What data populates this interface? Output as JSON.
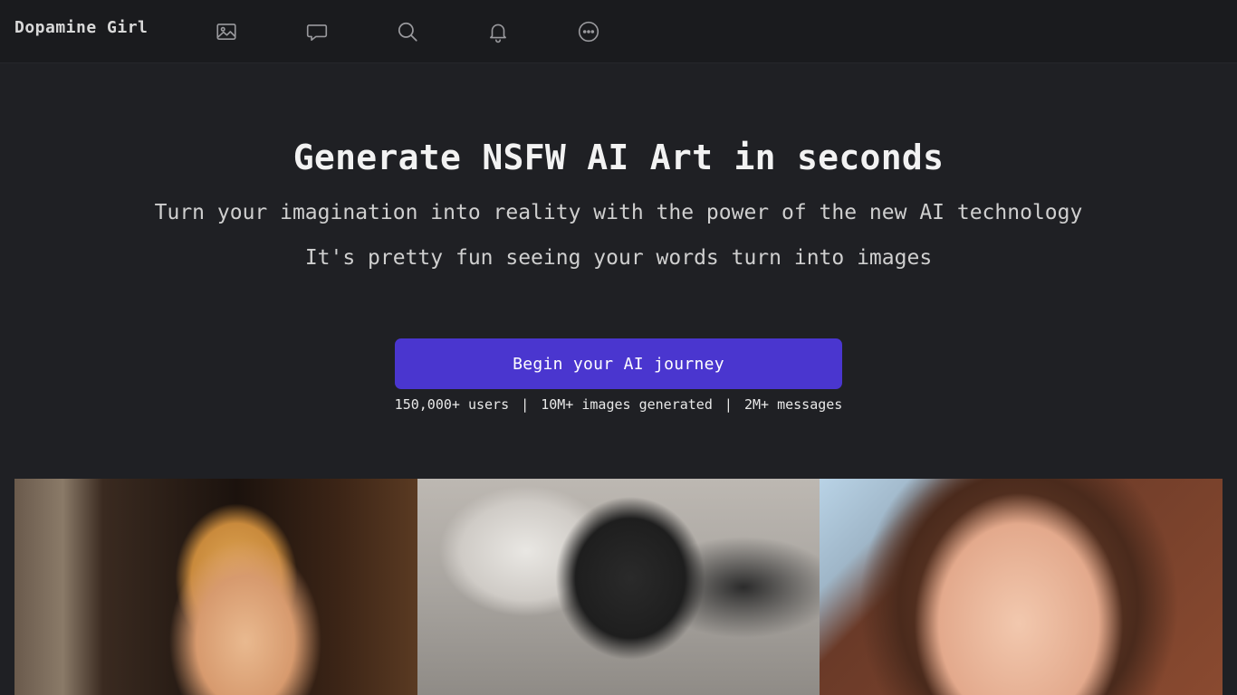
{
  "header": {
    "brand": "Dopamine Girl",
    "nav_icons": [
      "image-icon",
      "chat-icon",
      "search-icon",
      "bell-icon",
      "more-icon"
    ]
  },
  "hero": {
    "title": "Generate NSFW AI Art in seconds",
    "subtitle_1": "Turn your imagination into reality with the power of the new AI technology",
    "subtitle_2": "It's pretty fun seeing your words turn into images",
    "cta_label": "Begin your AI journey",
    "stats": {
      "users": "150,000+ users",
      "images": "10M+ images generated",
      "messages": "2M+ messages",
      "separator": "|"
    }
  },
  "gallery": {
    "tiles": [
      "blonde-braided-figure",
      "dark-haired-anime-girl",
      "brunette-portrait"
    ]
  },
  "colors": {
    "background": "#1f2024",
    "topbar": "#1a1b1e",
    "accent": "#4a36cf",
    "text": "#f2f2f2",
    "muted": "#cfcfcf",
    "icon": "#9a9a9e"
  }
}
